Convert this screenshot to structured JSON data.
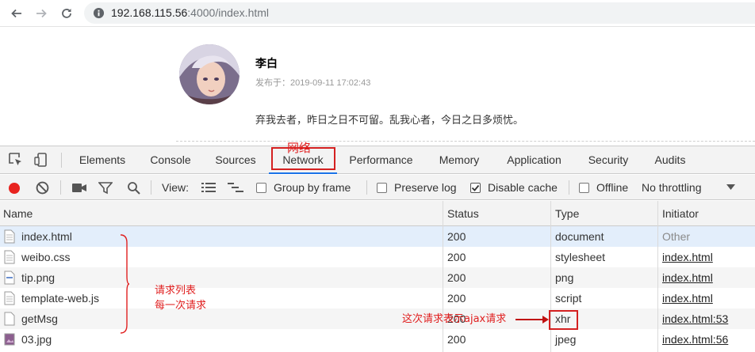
{
  "browser": {
    "url_host": "192.168.115.56",
    "url_rest": ":4000/index.html"
  },
  "post": {
    "author": "李白",
    "meta": "发布于：2019-09-11 17:02:43",
    "body": "弃我去者，昨日之日不可留。乱我心者，今日之日多烦忧。"
  },
  "devtools": {
    "tabs": [
      "Elements",
      "Console",
      "Sources",
      "Network",
      "Performance",
      "Memory",
      "Application",
      "Security",
      "Audits"
    ],
    "active_tab": "Network",
    "toolbar": {
      "view_label": "View:",
      "group_by_frame": "Group by frame",
      "preserve_log": "Preserve log",
      "disable_cache": "Disable cache",
      "offline": "Offline",
      "throttling": "No throttling"
    },
    "columns": [
      "Name",
      "Status",
      "Type",
      "Initiator"
    ],
    "rows": [
      {
        "name": "index.html",
        "status": "200",
        "type": "document",
        "initiator": "Other"
      },
      {
        "name": "weibo.css",
        "status": "200",
        "type": "stylesheet",
        "initiator": "index.html"
      },
      {
        "name": "tip.png",
        "status": "200",
        "type": "png",
        "initiator": "index.html"
      },
      {
        "name": "template-web.js",
        "status": "200",
        "type": "script",
        "initiator": "index.html"
      },
      {
        "name": "getMsg",
        "status": "200",
        "type": "xhr",
        "initiator": "index.html:53"
      },
      {
        "name": "03.jpg",
        "status": "200",
        "type": "jpeg",
        "initiator": "index.html:56"
      }
    ]
  },
  "annotations": {
    "network_label": "网络",
    "request_list_line1": "请求列表",
    "request_list_line2": "每一次请求",
    "ajax_note": "这次请求表示ajax请求"
  },
  "colors": {
    "annotation": "#e02020",
    "active_tab": "#1a73e8",
    "record": "#e8231f"
  }
}
